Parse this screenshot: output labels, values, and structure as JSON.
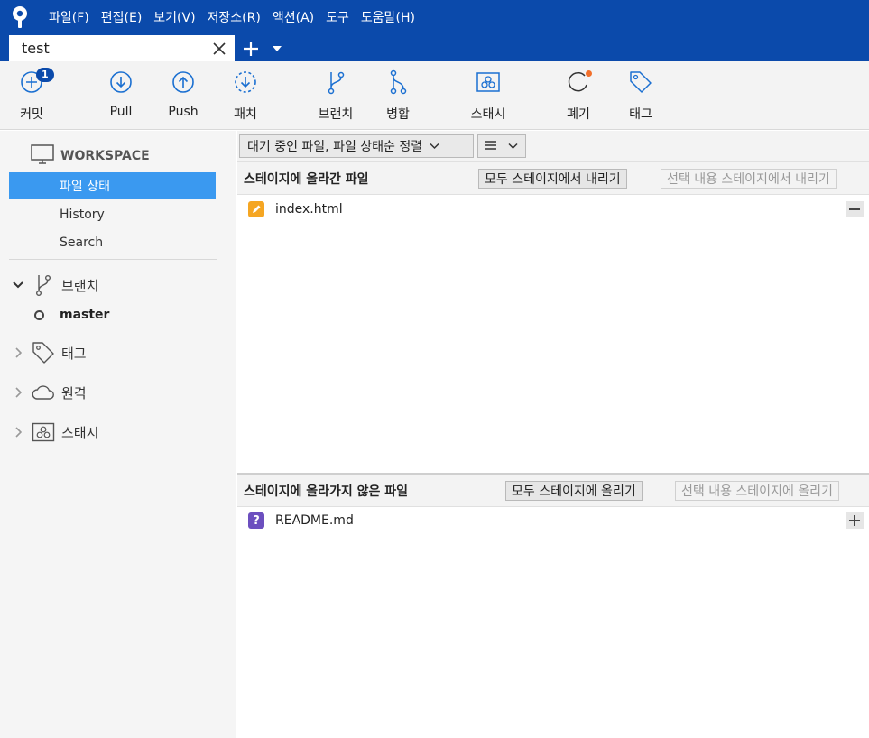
{
  "menu": [
    "파일(F)",
    "편집(E)",
    "보기(V)",
    "저장소(R)",
    "액션(A)",
    "도구",
    "도움말(H)"
  ],
  "tab": {
    "title": "test"
  },
  "toolbar": {
    "commit": {
      "label": "커밋",
      "badge": "1"
    },
    "pull": "Pull",
    "push": "Push",
    "patch": "패치",
    "branch": "브랜치",
    "merge": "병합",
    "stash": "스태시",
    "discard": "폐기",
    "tag": "태그"
  },
  "sidebar": {
    "workspace": "WORKSPACE",
    "items": [
      "파일 상태",
      "History",
      "Search"
    ],
    "branches": "브랜치",
    "current_branch": "master",
    "tags": "태그",
    "remotes": "원격",
    "stashes": "스태시"
  },
  "filters": {
    "sort": "대기 중인 파일, 파일 상태순 정렬",
    "view_icon": "list-icon"
  },
  "staged": {
    "title": "스테이지에 올라간 파일",
    "unstage_all": "모두 스테이지에서 내리기",
    "unstage_selected": "선택 내용 스테이지에서 내리기",
    "files": [
      {
        "name": "index.html",
        "status": "modified"
      }
    ]
  },
  "unstaged": {
    "title": "스테이지에 올라가지 않은 파일",
    "stage_all": "모두 스테이지에 올리기",
    "stage_selected": "선택 내용 스테이지에 올리기",
    "files": [
      {
        "name": "README.md",
        "status": "untracked"
      }
    ]
  },
  "colors": {
    "brand": "#0b4aab",
    "selection": "#3a99f0",
    "modified": "#f5a623",
    "untracked": "#6c4fbf",
    "discard_dot": "#f26f2a"
  }
}
